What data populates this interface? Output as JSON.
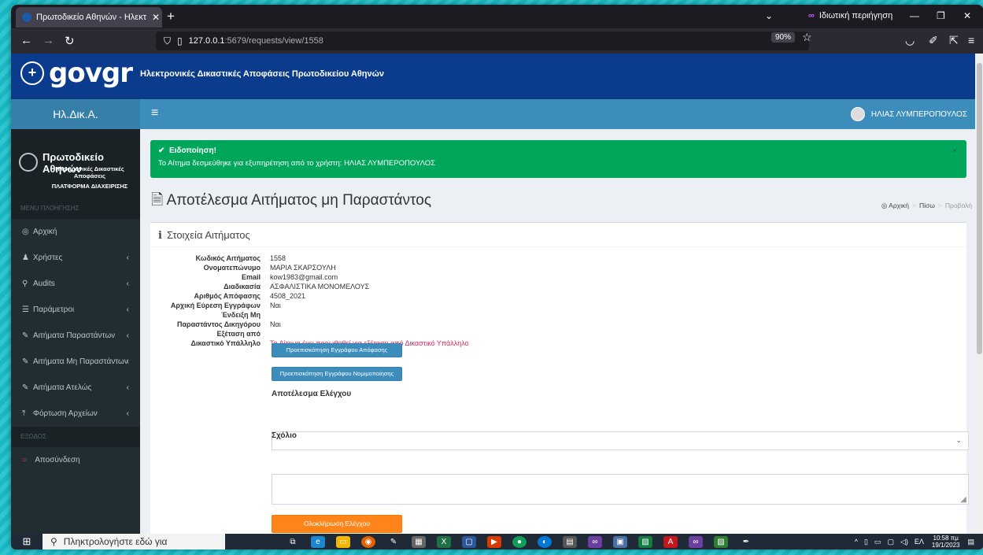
{
  "browser": {
    "tab_title": "Πρωτοδικείο Αθηνών - Ηλεκτ",
    "tab_close": "✕",
    "new_tab": "+",
    "private_label": "Ιδιωτική περιήγηση",
    "url_host": "127.0.0.1",
    "url_path": ":5679/requests/view/1558",
    "zoom": "90%"
  },
  "gov": {
    "logo": "govgr",
    "subtitle": "Ηλεκτρονικές Δικαστικές Αποφάσεις Πρωτοδικείου Αθηνών"
  },
  "topbar": {
    "brand": "Ηλ.Δικ.Α.",
    "user": "ΗΛΙΑΣ ΛΥΜΠΕΡΟΠΟΥΛΟΣ"
  },
  "sidebar": {
    "title": "Πρωτοδικείο Αθηνών",
    "subtitle": "Ηλεκτρονικές Δικαστικές Αποφάσεις",
    "platform": "ΠΛΑΤΦΟΡΜΑ ΔΙΑΧΕΙΡΙΣΗΣ",
    "menu_header": "MENU ΠΛΟΗΓΗΣΗΣ",
    "exit_header": "ΕΞΟΔΟΣ",
    "items": [
      {
        "label": "Αρχική",
        "icon": "dashboard-icon",
        "glyph": "◎",
        "arrow": ""
      },
      {
        "label": "Χρήστες",
        "icon": "user-icon",
        "glyph": "♟",
        "arrow": "‹"
      },
      {
        "label": "Audits",
        "icon": "search-icon",
        "glyph": "⚲",
        "arrow": "‹"
      },
      {
        "label": "Παράμετροι",
        "icon": "list-icon",
        "glyph": "☰",
        "arrow": "‹"
      },
      {
        "label": "Αιτήματα Παραστάντων",
        "icon": "edit-icon",
        "glyph": "✎",
        "arrow": "‹"
      },
      {
        "label": "Αιτήματα Μη Παραστάντων",
        "icon": "edit-icon",
        "glyph": "✎",
        "arrow": "‹"
      },
      {
        "label": "Αιτήματα Ατελώς",
        "icon": "edit-icon",
        "glyph": "✎",
        "arrow": "‹"
      },
      {
        "label": "Φόρτωση Αρχείων",
        "icon": "upload-icon",
        "glyph": "⤒",
        "arrow": "‹"
      }
    ],
    "logout": {
      "label": "Αποσύνδεση",
      "icon": "circle-icon",
      "glyph": "○"
    }
  },
  "alert": {
    "heading": "Ειδοποίηση!",
    "message": "Το Αίτημα δεσμεύθηκε για εξυπηρέτηση από το χρήστη: ΗΛΙΑΣ ΛΥΜΠΕΡΟΠΟΥΛΟΣ",
    "close": "×",
    "color": "#00a65a"
  },
  "page": {
    "title": "Αποτέλεσμα Αιτήματος μη Παραστάντος",
    "breadcrumb": [
      "Αρχική",
      "Πίσω",
      "Προβολή"
    ]
  },
  "details": {
    "box_title": "Στοιχεία Αιτήματος",
    "fields": [
      {
        "label": "Κωδικός Αιτήματος",
        "value": "1558"
      },
      {
        "label": "Ονοματεπώνυμο",
        "value": "ΜΑΡΙΑ ΣΚΑΡΣΟΥΛΗ"
      },
      {
        "label": "Email",
        "value": "kow1983@gmail.com"
      },
      {
        "label": "Διαδικασία",
        "value": "ΑΣΦΑΛΙΣΤΙΚΑ ΜΟΝΟΜΕΛΟΥΣ"
      },
      {
        "label": "Αριθμός Απόφασης",
        "value": "4508_2021"
      },
      {
        "label": "Αρχική Εύρεση Εγγράφων",
        "value": "Ναι"
      },
      {
        "label": "Ένδειξη Μη",
        "value": ""
      },
      {
        "label": "Παραστάντος Δικηγόρου",
        "value": "Ναι"
      },
      {
        "label": "Εξέταση από",
        "value": ""
      },
      {
        "label": "Δικαστικό Υπάλληλο",
        "value": "Το Αίτημα έχει προωθηθεί για εξέταση από Δικαστικό Υπάλληλο"
      }
    ],
    "preview_decision": "Προεπισκόπηση Εγγράφου Απόφασης",
    "preview_legal": "Προεπισκόπηση Εγγράφου Νομιμοποίησης",
    "result_label": "Αποτέλεσμα Ελέγχου",
    "result_value": "",
    "comment_label": "Σχόλιο",
    "complete_button": "Ολοκλήρωση Ελέγχου"
  },
  "taskbar": {
    "search_placeholder": "Πληκτρολογήστε εδώ για",
    "lang": "ΕΛ",
    "time": "10:58 πμ",
    "date": "19/1/2023"
  }
}
